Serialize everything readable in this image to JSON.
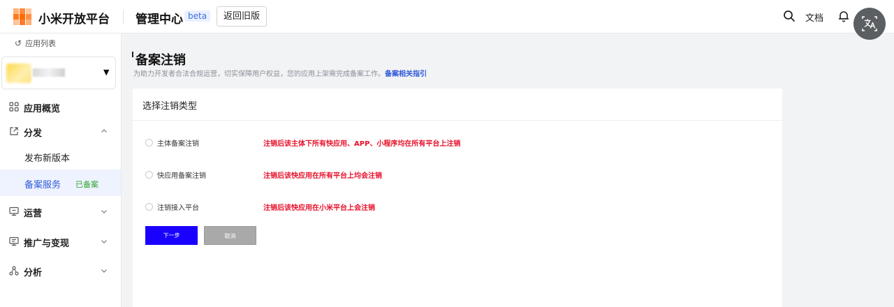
{
  "header": {
    "brand": "小米开放平台",
    "section": "管理中心",
    "beta_badge": "beta",
    "old_version_button": "返回旧版",
    "docs_link": "文档"
  },
  "sidebar": {
    "back_link": "应用列表",
    "nav": [
      {
        "label": "应用概览",
        "icon": "grid-icon"
      },
      {
        "label": "分发",
        "icon": "external-link-icon",
        "expanded": true,
        "children": [
          {
            "label": "发布新版本"
          },
          {
            "label": "备案服务",
            "badge": "已备案",
            "active": true
          }
        ]
      },
      {
        "label": "运营",
        "icon": "monitor-icon"
      },
      {
        "label": "推广与变现",
        "icon": "monitor-chat-icon"
      },
      {
        "label": "分析",
        "icon": "nodes-icon"
      }
    ]
  },
  "page": {
    "title": "备案注销",
    "description": "为助力开发者合法合规运营，切实保障用户权益，您的应用上架需完成备案工作。",
    "guide_link": "备案相关指引"
  },
  "card": {
    "title": "选择注销类型",
    "options": [
      {
        "label": "主体备案注销",
        "note": "注销后该主体下所有快应用、APP、小程序均在所有平台上注销"
      },
      {
        "label": "快应用备案注销",
        "note": "注销后该快应用在所有平台上均会注销"
      },
      {
        "label": "注销接入平台",
        "note": "注销后该快应用在小米平台上会注销"
      }
    ],
    "next_button": "下一步",
    "cancel_button": "取消"
  },
  "colors": {
    "accent": "#2f5ad8",
    "primary_button": "#1a00ff",
    "danger_text": "#e8102a",
    "success_text": "#2fa32f"
  }
}
